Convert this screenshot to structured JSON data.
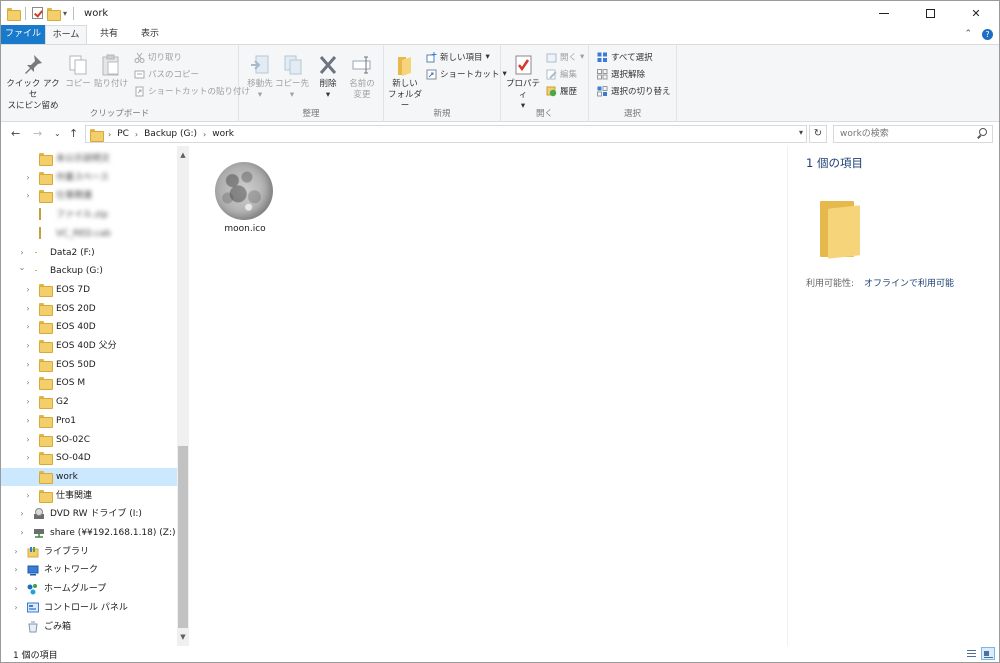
{
  "window": {
    "title": "work"
  },
  "ribbon_tabs": {
    "file": "ファイル",
    "home": "ホーム",
    "share": "共有",
    "view": "表示"
  },
  "ribbon": {
    "clipboard": {
      "label": "クリップボード",
      "pin_line1": "クイック アクセ",
      "pin_line2": "スにピン留め",
      "copy": "コピー",
      "paste": "貼り付け",
      "cut": "切り取り",
      "copy_path": "パスのコピー",
      "paste_shortcut": "ショートカットの貼り付け"
    },
    "organize": {
      "label": "整理",
      "move_to": "移動先",
      "copy_to": "コピー先",
      "delete": "削除",
      "rename_line1": "名前の",
      "rename_line2": "変更"
    },
    "new": {
      "label": "新規",
      "new_folder_line1": "新しい",
      "new_folder_line2": "フォルダー",
      "new_item": "新しい項目",
      "shortcut": "ショートカット"
    },
    "open": {
      "label": "開く",
      "properties": "プロパティ",
      "open": "開く",
      "edit": "編集",
      "history": "履歴"
    },
    "select": {
      "label": "選択",
      "select_all": "すべて選択",
      "select_none": "選択解除",
      "invert": "選択の切り替え"
    }
  },
  "address": {
    "crumbs": [
      "PC",
      "Backup (G:)",
      "work"
    ],
    "search_placeholder": "workの検索"
  },
  "nav_tree": [
    {
      "label": "未公示説明文",
      "blurred": true
    },
    {
      "label": "作業スペース",
      "blurred": true
    },
    {
      "label": "仕事関連",
      "blurred": true
    },
    {
      "label": "ファイル.zip",
      "blurred": true
    },
    {
      "label": "VC_RED.cab",
      "blurred": true
    },
    {
      "label": "Data2 (F:)"
    },
    {
      "label": "Backup (G:)"
    },
    {
      "label": "EOS 7D"
    },
    {
      "label": "EOS 20D"
    },
    {
      "label": "EOS 40D"
    },
    {
      "label": "EOS 40D 父分"
    },
    {
      "label": "EOS 50D"
    },
    {
      "label": "EOS M"
    },
    {
      "label": "G2"
    },
    {
      "label": "Pro1"
    },
    {
      "label": "SO-02C"
    },
    {
      "label": "SO-04D"
    },
    {
      "label": "work"
    },
    {
      "label": "仕事関連"
    },
    {
      "label": "DVD RW ドライブ (I:)"
    },
    {
      "label": "share (¥¥192.168.1.18) (Z:)"
    },
    {
      "label": "ライブラリ"
    },
    {
      "label": "ネットワーク"
    },
    {
      "label": "ホームグループ"
    },
    {
      "label": "コントロール パネル"
    },
    {
      "label": "ごみ箱"
    }
  ],
  "content": {
    "files": [
      {
        "name": "moon.ico"
      }
    ]
  },
  "details": {
    "title": "1 個の項目",
    "availability_label": "利用可能性:",
    "availability_value": "オフラインで利用可能"
  },
  "status": {
    "text": "1 個の項目"
  }
}
